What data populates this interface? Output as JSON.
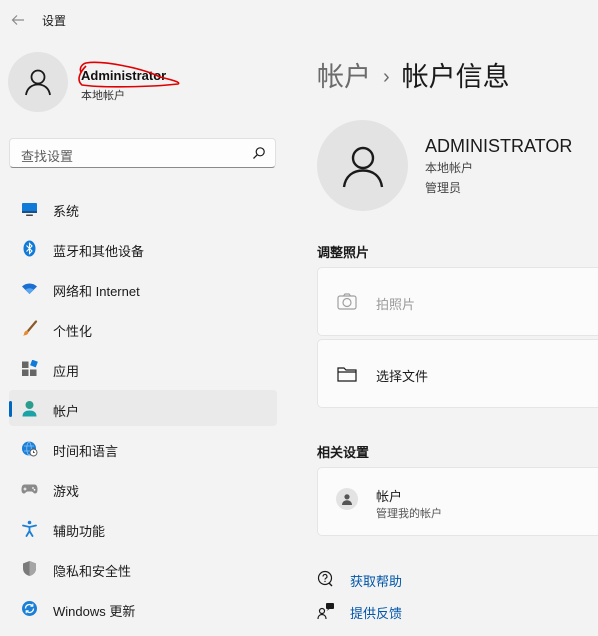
{
  "window": {
    "title": "设置"
  },
  "profile": {
    "name": "Administrator",
    "account_type": "本地帐户"
  },
  "search": {
    "placeholder": "查找设置"
  },
  "nav": {
    "items": [
      {
        "label": "系统",
        "icon": "monitor-icon",
        "active": false
      },
      {
        "label": "蓝牙和其他设备",
        "icon": "bluetooth-icon",
        "active": false
      },
      {
        "label": "网络和 Internet",
        "icon": "wifi-icon",
        "active": false
      },
      {
        "label": "个性化",
        "icon": "brush-icon",
        "active": false
      },
      {
        "label": "应用",
        "icon": "apps-icon",
        "active": false
      },
      {
        "label": "帐户",
        "icon": "person-icon",
        "active": true
      },
      {
        "label": "时间和语言",
        "icon": "globe-clock-icon",
        "active": false
      },
      {
        "label": "游戏",
        "icon": "gamepad-icon",
        "active": false
      },
      {
        "label": "辅助功能",
        "icon": "accessibility-icon",
        "active": false
      },
      {
        "label": "隐私和安全性",
        "icon": "shield-icon",
        "active": false
      },
      {
        "label": "Windows 更新",
        "icon": "update-icon",
        "active": false
      }
    ]
  },
  "breadcrumb": {
    "parent": "帐户",
    "separator": "›",
    "current": "帐户信息"
  },
  "account": {
    "name": "ADMINISTRATOR",
    "type": "本地帐户",
    "role": "管理员"
  },
  "adjust_photo": {
    "title": "调整照片",
    "take_photo": "拍照片",
    "choose_file": "选择文件"
  },
  "related": {
    "title": "相关设置",
    "accounts_label": "帐户",
    "accounts_sub": "管理我的帐户"
  },
  "help": {
    "get_help": "获取帮助",
    "feedback": "提供反馈"
  },
  "colors": {
    "accent": "#0067c0",
    "link": "#0055a8",
    "background": "#f3f3f3",
    "annotation": "#e00000"
  }
}
